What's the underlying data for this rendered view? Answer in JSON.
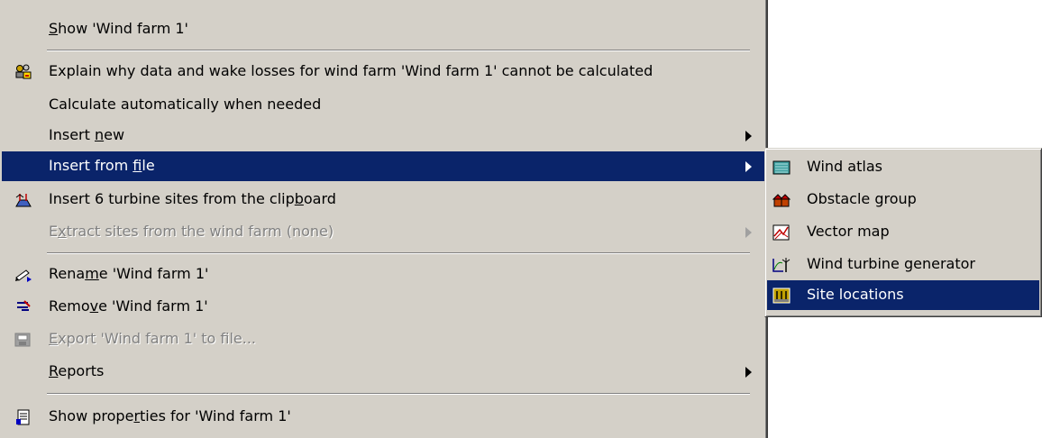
{
  "main_menu": {
    "show_wind_farm": [
      "",
      "S",
      "how 'Wind farm 1'"
    ],
    "explain": "Explain why data and wake losses for wind farm 'Wind farm 1' cannot be calculated",
    "calc_auto": "Calculate automatically when needed",
    "insert_new": [
      "Insert ",
      "n",
      "ew"
    ],
    "insert_from_file": [
      "Insert from ",
      "f",
      "ile"
    ],
    "insert_sites": [
      "Insert 6 turbine sites from the clip",
      "b",
      "oard"
    ],
    "extract_sites": [
      "E",
      "x",
      "tract sites from the wind farm (none)"
    ],
    "rename": [
      "Rena",
      "m",
      "e 'Wind farm 1'"
    ],
    "remove": [
      "Remo",
      "v",
      "e 'Wind farm 1'"
    ],
    "export": [
      "",
      "E",
      "xport 'Wind farm 1' to file..."
    ],
    "reports": [
      "",
      "R",
      "eports"
    ],
    "show_properties": [
      "Show prope",
      "r",
      "ties for 'Wind farm 1'"
    ]
  },
  "sub_menu": {
    "items": [
      "Wind atlas",
      "Obstacle group",
      "Vector map",
      "Wind turbine generator",
      "Site locations"
    ]
  },
  "icons": {
    "explain": "hazard-people-icon",
    "insert_sites": "turbine-clipboard-icon",
    "rename": "rename-pencil-icon",
    "remove": "remove-icon",
    "export": "export-icon",
    "show_properties": "properties-icon",
    "wind_atlas": "wind-atlas-icon",
    "obstacle_group": "obstacle-group-icon",
    "vector_map": "vector-map-icon",
    "wind_turbine_generator": "wind-turbine-generator-icon",
    "site_locations": "site-locations-icon"
  },
  "colors": {
    "menu_bg": "#d4d0c8",
    "highlight": "#0a246a",
    "disabled_text": "#808080"
  }
}
